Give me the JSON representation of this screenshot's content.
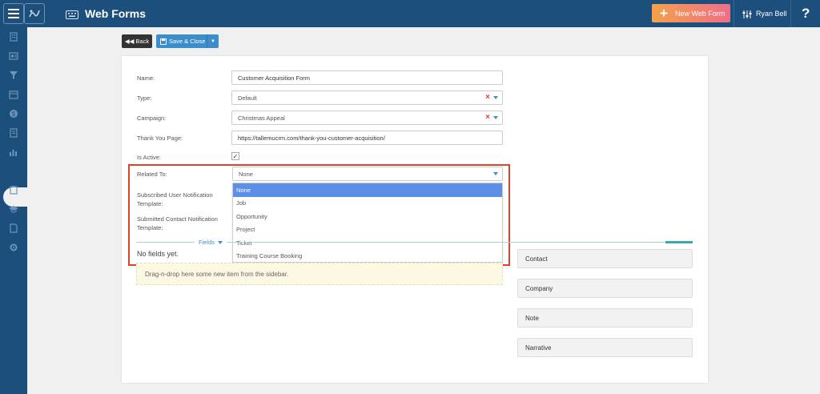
{
  "header": {
    "title": "Web Forms",
    "new_button_label": "New Web Form",
    "user_name": "Ryan Bell",
    "help_label": "?"
  },
  "toolbar": {
    "back_label": "Back",
    "save_label": "Save & Close"
  },
  "form": {
    "name": {
      "label": "Name:",
      "value": "Customer Acquisition Form"
    },
    "type": {
      "label": "Type:",
      "value": "Default"
    },
    "campaign": {
      "label": "Campaign:",
      "value": "Christmas Appeal"
    },
    "thank_you_page": {
      "label": "Thank You Page:",
      "value": "https://tallemucrm.com/thank-you-customer-acquisition/"
    },
    "is_active": {
      "label": "Is Active:",
      "checked": true
    },
    "related_to": {
      "label": "Related To:",
      "value": "None",
      "options": [
        "None",
        "Job",
        "Opportunity",
        "Project",
        "Ticket",
        "Training Course Booking"
      ],
      "selected_index": 0
    },
    "subscribed_user_notification": {
      "label_line1": "Subscribed User Notification",
      "label_line2": "Template:"
    },
    "submitted_contact_notification": {
      "label_line1": "Submitted Contact Notification",
      "label_line2": "Template:"
    }
  },
  "fields_section": {
    "label": "Fields",
    "empty_text": "No fields yet.",
    "drop_hint": "Drag-n-drop here some new item from the sidebar."
  },
  "sidebar_items": [
    "Contact",
    "Company",
    "Note",
    "Narrative"
  ],
  "colors": {
    "nav_bg": "#1d4f7c",
    "accent": "#3c8dcb",
    "highlight": "#e0412b",
    "selected_option": "#5b8fe8"
  }
}
